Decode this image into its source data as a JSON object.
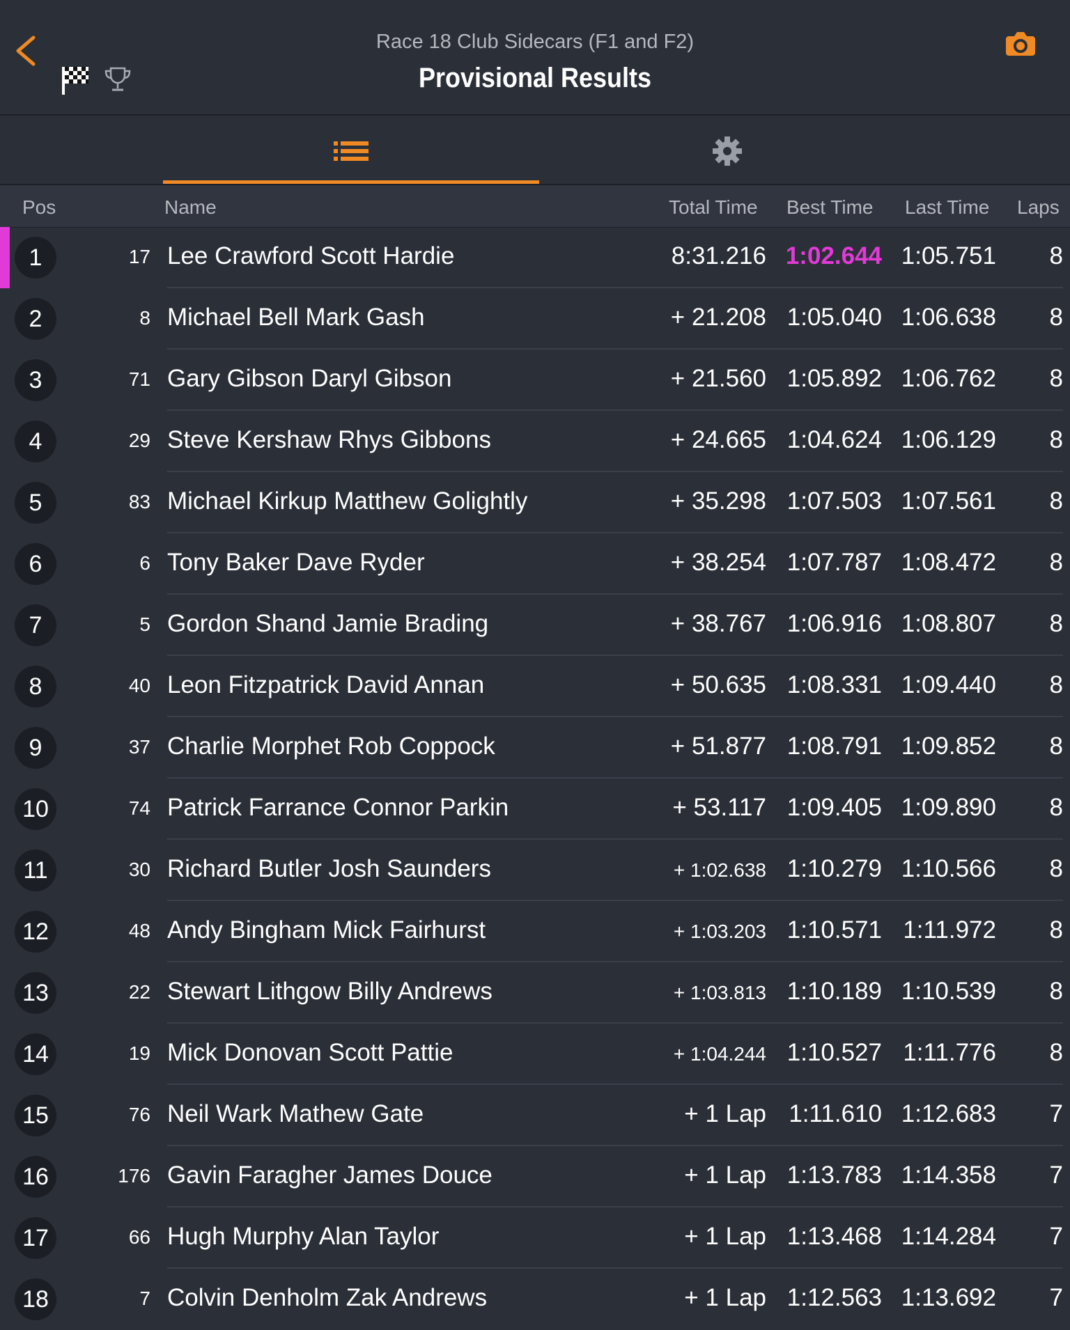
{
  "header": {
    "subtitle": "Race 18 Club Sidecars (F1 and F2)",
    "title": "Provisional Results",
    "back_icon": "chevron-left-icon",
    "flag_icon": "checkered-flag-icon",
    "trophy_icon": "trophy-icon",
    "camera_icon": "camera-icon"
  },
  "tabs": [
    {
      "icon": "list-icon",
      "active": true
    },
    {
      "icon": "gear-icon",
      "active": false
    }
  ],
  "columns": {
    "pos": "Pos",
    "name": "Name",
    "total": "Total Time",
    "best": "Best Time",
    "last": "Last Time",
    "laps": "Laps"
  },
  "colors": {
    "accent": "#f08a24",
    "fastest": "#e23ad8",
    "background": "#2b2f38",
    "position_badge": "#1b1e24"
  },
  "rows": [
    {
      "pos": "1",
      "num": "17",
      "name": "Lee Crawford Scott Hardie",
      "total": "8:31.216",
      "best": "1:02.644",
      "last": "1:05.751",
      "laps": "8",
      "fastest_lap": true
    },
    {
      "pos": "2",
      "num": "8",
      "name": "Michael Bell Mark Gash",
      "total": "+ 21.208",
      "best": "1:05.040",
      "last": "1:06.638",
      "laps": "8"
    },
    {
      "pos": "3",
      "num": "71",
      "name": "Gary Gibson Daryl Gibson",
      "total": "+ 21.560",
      "best": "1:05.892",
      "last": "1:06.762",
      "laps": "8"
    },
    {
      "pos": "4",
      "num": "29",
      "name": "Steve Kershaw Rhys Gibbons",
      "total": "+ 24.665",
      "best": "1:04.624",
      "last": "1:06.129",
      "laps": "8"
    },
    {
      "pos": "5",
      "num": "83",
      "name": "Michael Kirkup Matthew Golightly",
      "total": "+ 35.298",
      "best": "1:07.503",
      "last": "1:07.561",
      "laps": "8"
    },
    {
      "pos": "6",
      "num": "6",
      "name": "Tony Baker Dave Ryder",
      "total": "+ 38.254",
      "best": "1:07.787",
      "last": "1:08.472",
      "laps": "8"
    },
    {
      "pos": "7",
      "num": "5",
      "name": "Gordon Shand Jamie Brading",
      "total": "+ 38.767",
      "best": "1:06.916",
      "last": "1:08.807",
      "laps": "8"
    },
    {
      "pos": "8",
      "num": "40",
      "name": "Leon Fitzpatrick David Annan",
      "total": "+ 50.635",
      "best": "1:08.331",
      "last": "1:09.440",
      "laps": "8"
    },
    {
      "pos": "9",
      "num": "37",
      "name": "Charlie Morphet Rob Coppock",
      "total": "+ 51.877",
      "best": "1:08.791",
      "last": "1:09.852",
      "laps": "8"
    },
    {
      "pos": "10",
      "num": "74",
      "name": "Patrick Farrance Connor Parkin",
      "total": "+ 53.117",
      "best": "1:09.405",
      "last": "1:09.890",
      "laps": "8"
    },
    {
      "pos": "11",
      "num": "30",
      "name": "Richard Butler Josh Saunders",
      "total": "+ 1:02.638",
      "best": "1:10.279",
      "last": "1:10.566",
      "laps": "8",
      "small_total": true
    },
    {
      "pos": "12",
      "num": "48",
      "name": "Andy Bingham Mick Fairhurst",
      "total": "+ 1:03.203",
      "best": "1:10.571",
      "last": "1:11.972",
      "laps": "8",
      "small_total": true
    },
    {
      "pos": "13",
      "num": "22",
      "name": "Stewart Lithgow Billy Andrews",
      "total": "+ 1:03.813",
      "best": "1:10.189",
      "last": "1:10.539",
      "laps": "8",
      "small_total": true
    },
    {
      "pos": "14",
      "num": "19",
      "name": "Mick Donovan Scott Pattie",
      "total": "+ 1:04.244",
      "best": "1:10.527",
      "last": "1:11.776",
      "laps": "8",
      "small_total": true
    },
    {
      "pos": "15",
      "num": "76",
      "name": "Neil Wark Mathew Gate",
      "total": "+ 1 Lap",
      "best": "1:11.610",
      "last": "1:12.683",
      "laps": "7"
    },
    {
      "pos": "16",
      "num": "176",
      "name": "Gavin Faragher James Douce",
      "total": "+ 1 Lap",
      "best": "1:13.783",
      "last": "1:14.358",
      "laps": "7"
    },
    {
      "pos": "17",
      "num": "66",
      "name": "Hugh Murphy Alan Taylor",
      "total": "+ 1 Lap",
      "best": "1:13.468",
      "last": "1:14.284",
      "laps": "7"
    },
    {
      "pos": "18",
      "num": "7",
      "name": "Colvin Denholm Zak Andrews",
      "total": "+ 1 Lap",
      "best": "1:12.563",
      "last": "1:13.692",
      "laps": "7"
    }
  ]
}
